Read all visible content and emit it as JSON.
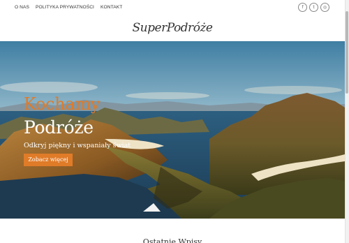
{
  "nav": {
    "items": [
      {
        "label": "O NAS"
      },
      {
        "label": "POLITYKA PRYWATNOŚCI"
      },
      {
        "label": "KONTAKT"
      }
    ]
  },
  "social": {
    "icons": [
      "facebook-icon",
      "twitter-icon",
      "instagram-icon"
    ],
    "glyphs": [
      "f",
      "t",
      "◎"
    ]
  },
  "brand": {
    "logo_text": "SuperPodróże"
  },
  "hero": {
    "headline_line1": "Kochamy",
    "headline_line2": "Podróże",
    "tagline": "Odkryj piękny i wspaniały świat",
    "cta_label": "Zobacz więcej"
  },
  "section": {
    "title": "Ostatnie Wpisy"
  },
  "colors": {
    "accent": "#e07b28",
    "text": "#333333"
  }
}
